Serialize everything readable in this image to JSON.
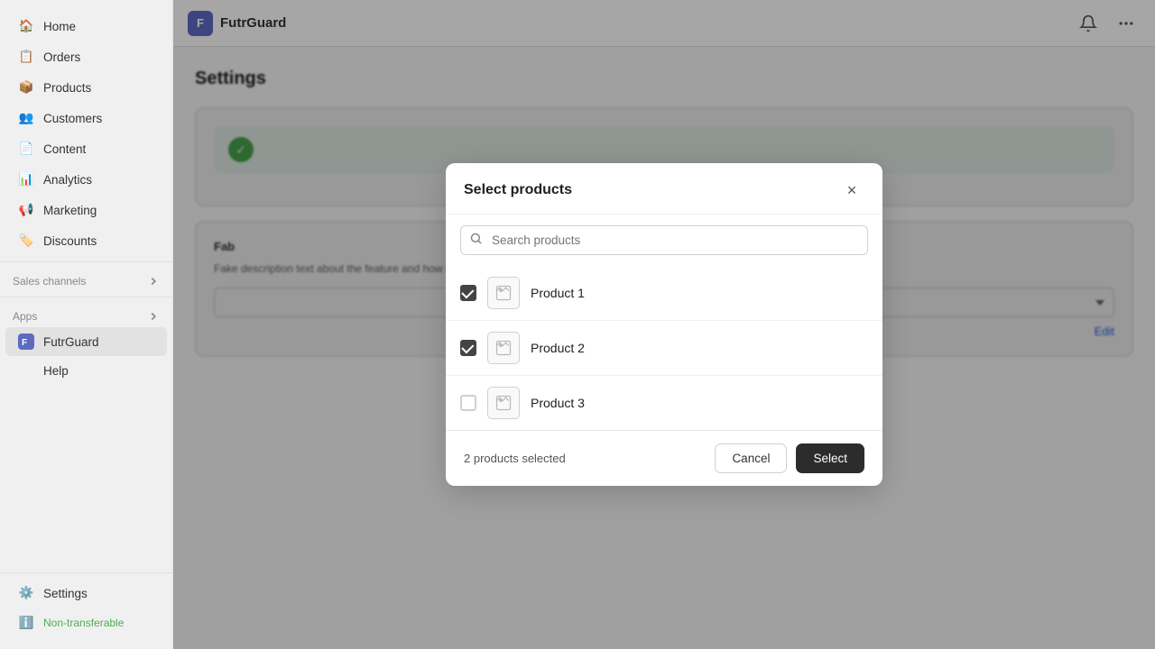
{
  "brand": {
    "name": "FutrGuard",
    "icon_letter": "F"
  },
  "sidebar": {
    "nav_items": [
      {
        "id": "home",
        "label": "Home",
        "icon": "🏠"
      },
      {
        "id": "orders",
        "label": "Orders",
        "icon": "📋"
      },
      {
        "id": "products",
        "label": "Products",
        "icon": "📦"
      },
      {
        "id": "customers",
        "label": "Customers",
        "icon": "👥"
      },
      {
        "id": "content",
        "label": "Content",
        "icon": "📄"
      },
      {
        "id": "analytics",
        "label": "Analytics",
        "icon": "📊"
      },
      {
        "id": "marketing",
        "label": "Marketing",
        "icon": "📢"
      },
      {
        "id": "discounts",
        "label": "Discounts",
        "icon": "🏷️"
      }
    ],
    "sales_channels_label": "Sales channels",
    "apps_label": "Apps",
    "apps_items": [
      {
        "id": "futrguard",
        "label": "FutrGuard",
        "active": true
      },
      {
        "id": "help",
        "label": "Help",
        "active": false
      }
    ],
    "bottom_items": [
      {
        "id": "settings",
        "label": "Settings",
        "icon": "⚙️"
      },
      {
        "id": "non-transferable",
        "label": "Non-transferable",
        "icon": "ℹ️"
      }
    ]
  },
  "page": {
    "title": "Settings",
    "card_check_text": "",
    "fab_title": "Fab",
    "fab_description": "Fake description text about the feature and how it works each week.",
    "edit_label": "Edit"
  },
  "modal": {
    "title": "Select products",
    "search_placeholder": "Search products",
    "products": [
      {
        "id": "p1",
        "name": "Product 1",
        "checked": true
      },
      {
        "id": "p2",
        "name": "Product 2",
        "checked": true
      },
      {
        "id": "p3",
        "name": "Product 3",
        "checked": false
      }
    ],
    "selected_count_text": "2 products selected",
    "cancel_label": "Cancel",
    "select_label": "Select"
  }
}
